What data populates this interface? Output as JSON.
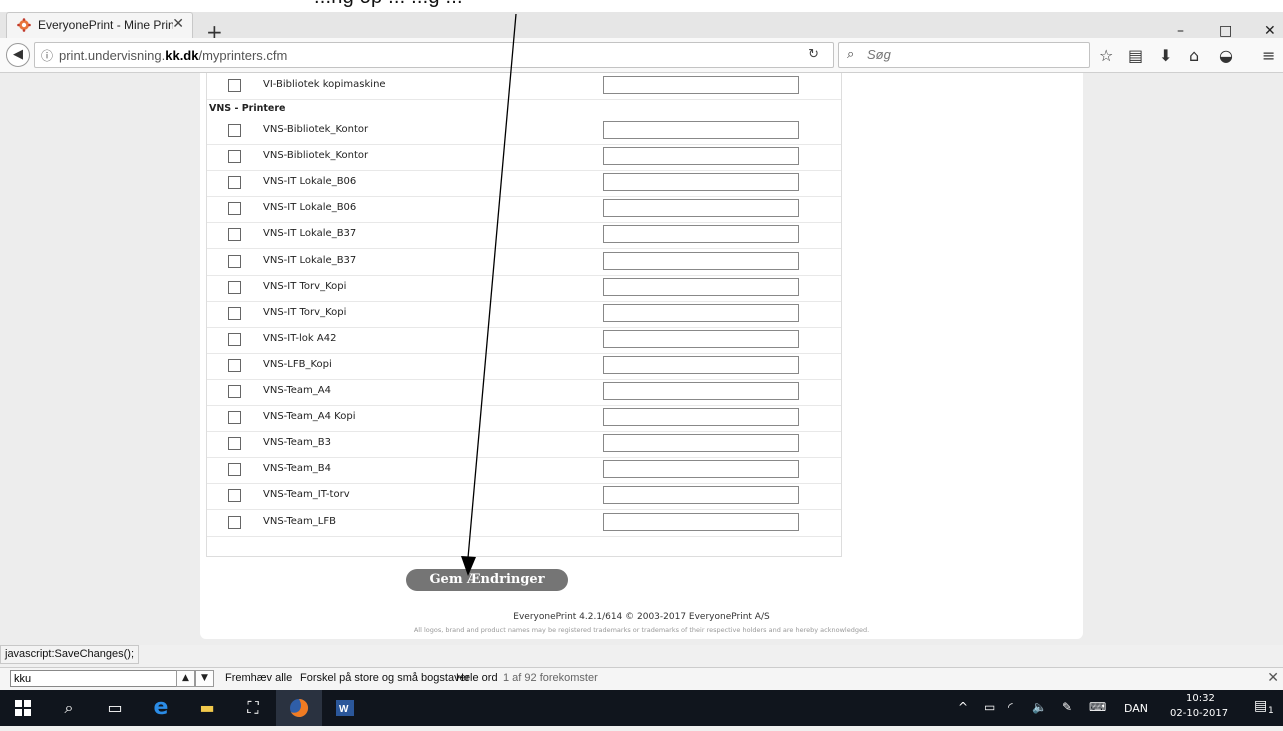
{
  "overlay": {
    "instruction_text": "...ng op ... ...g ..."
  },
  "browser": {
    "tab_title": "EveryonePrint - Mine Printer",
    "new_tab": "+",
    "url_prefix": "print.undervisning.",
    "url_domain": "kk.dk",
    "url_path": "/myprinters.cfm",
    "search_placeholder": "Søg",
    "window_minimize": "–",
    "window_maximize": "□",
    "window_close": "✕"
  },
  "printers": {
    "top_row": "VI-Bibliotek kopimaskine",
    "group_header": "VNS - Printere",
    "items": [
      "VNS-Bibliotek_Kontor",
      "VNS-Bibliotek_Kontor",
      "VNS-IT Lokale_B06",
      "VNS-IT Lokale_B06",
      "VNS-IT Lokale_B37",
      "VNS-IT Lokale_B37",
      "VNS-IT Torv_Kopi",
      "VNS-IT Torv_Kopi",
      "VNS-IT-lok A42",
      "VNS-LFB_Kopi",
      "VNS-Team_A4",
      "VNS-Team_A4 Kopi",
      "VNS-Team_B3",
      "VNS-Team_B4",
      "VNS-Team_IT-torv",
      "VNS-Team_LFB"
    ]
  },
  "save_button": "Gem Ændringer",
  "footer": {
    "line1": "EveryonePrint 4.2.1/614 © 2003-2017 EveryonePrint A/S",
    "line2": "All logos, brand and product names may be registered trademarks or trademarks of their respective holders and are hereby acknowledged."
  },
  "status_url": "javascript:SaveChanges();",
  "find_bar": {
    "query": "kku",
    "highlight_all": "Fremhæv alle",
    "match_case": "Forskel på store og små bogstaver",
    "whole_words": "Hele ord",
    "result_count": "1 af 92 forekomster"
  },
  "taskbar": {
    "language": "DAN",
    "time": "10:32",
    "date": "02-10-2017",
    "notification_count": "1"
  },
  "colors": {
    "save_button_bg": "#757575",
    "taskbar_bg": "#10151d",
    "page_bg": "#ededed"
  }
}
